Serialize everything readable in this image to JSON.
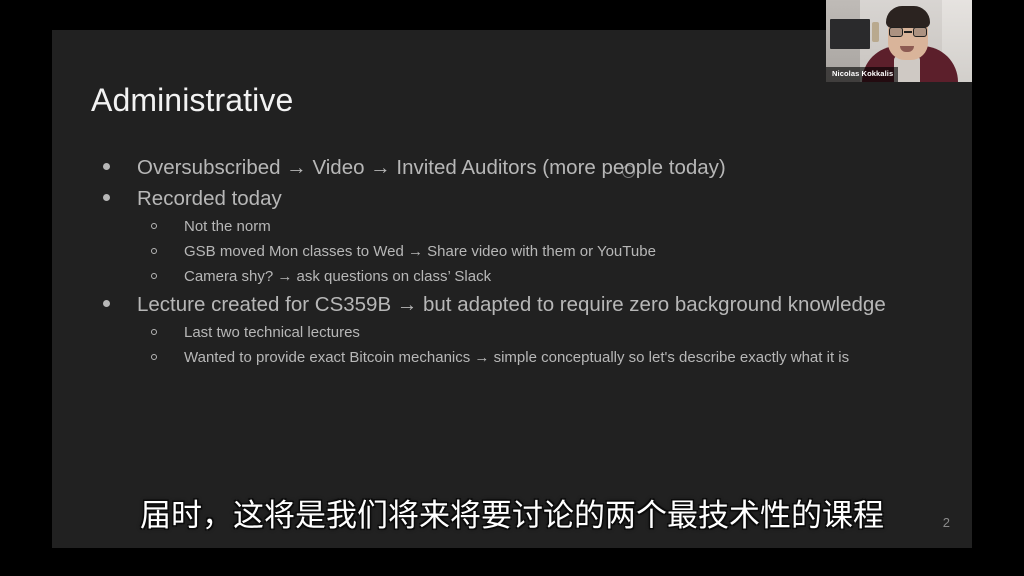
{
  "slide": {
    "title": "Administrative",
    "page_number": "2",
    "background_color": "#212121",
    "title_color": "#f2f2f2",
    "body_color": "#b7b7b7",
    "bullets": [
      {
        "level": 1,
        "marker": "filled-disc",
        "text": "Oversubscribed → Video → Invited Auditors (more people today)"
      },
      {
        "level": 1,
        "marker": "filled-disc",
        "text": "Recorded today"
      },
      {
        "level": 2,
        "marker": "hollow-circle",
        "text": "Not the norm"
      },
      {
        "level": 2,
        "marker": "hollow-circle",
        "text": "GSB moved Mon classes to Wed → Share video with them or YouTube"
      },
      {
        "level": 2,
        "marker": "hollow-circle",
        "text": "Camera shy? → ask questions on class’ Slack"
      },
      {
        "level": 1,
        "marker": "filled-disc",
        "text": "Lecture created for CS359B → but adapted to require zero background knowledge"
      },
      {
        "level": 2,
        "marker": "hollow-circle",
        "text": "Last two technical lectures"
      },
      {
        "level": 2,
        "marker": "hollow-circle",
        "text": "Wanted to provide exact Bitcoin mechanics → simple conceptually so let's describe exactly what it is"
      }
    ]
  },
  "webcam": {
    "participant_name": "Nicolas Kokkalis"
  },
  "subtitle": {
    "text": "届时，这将是我们将来将要讨论的两个最技术性的课程",
    "color": "#ffffff"
  }
}
